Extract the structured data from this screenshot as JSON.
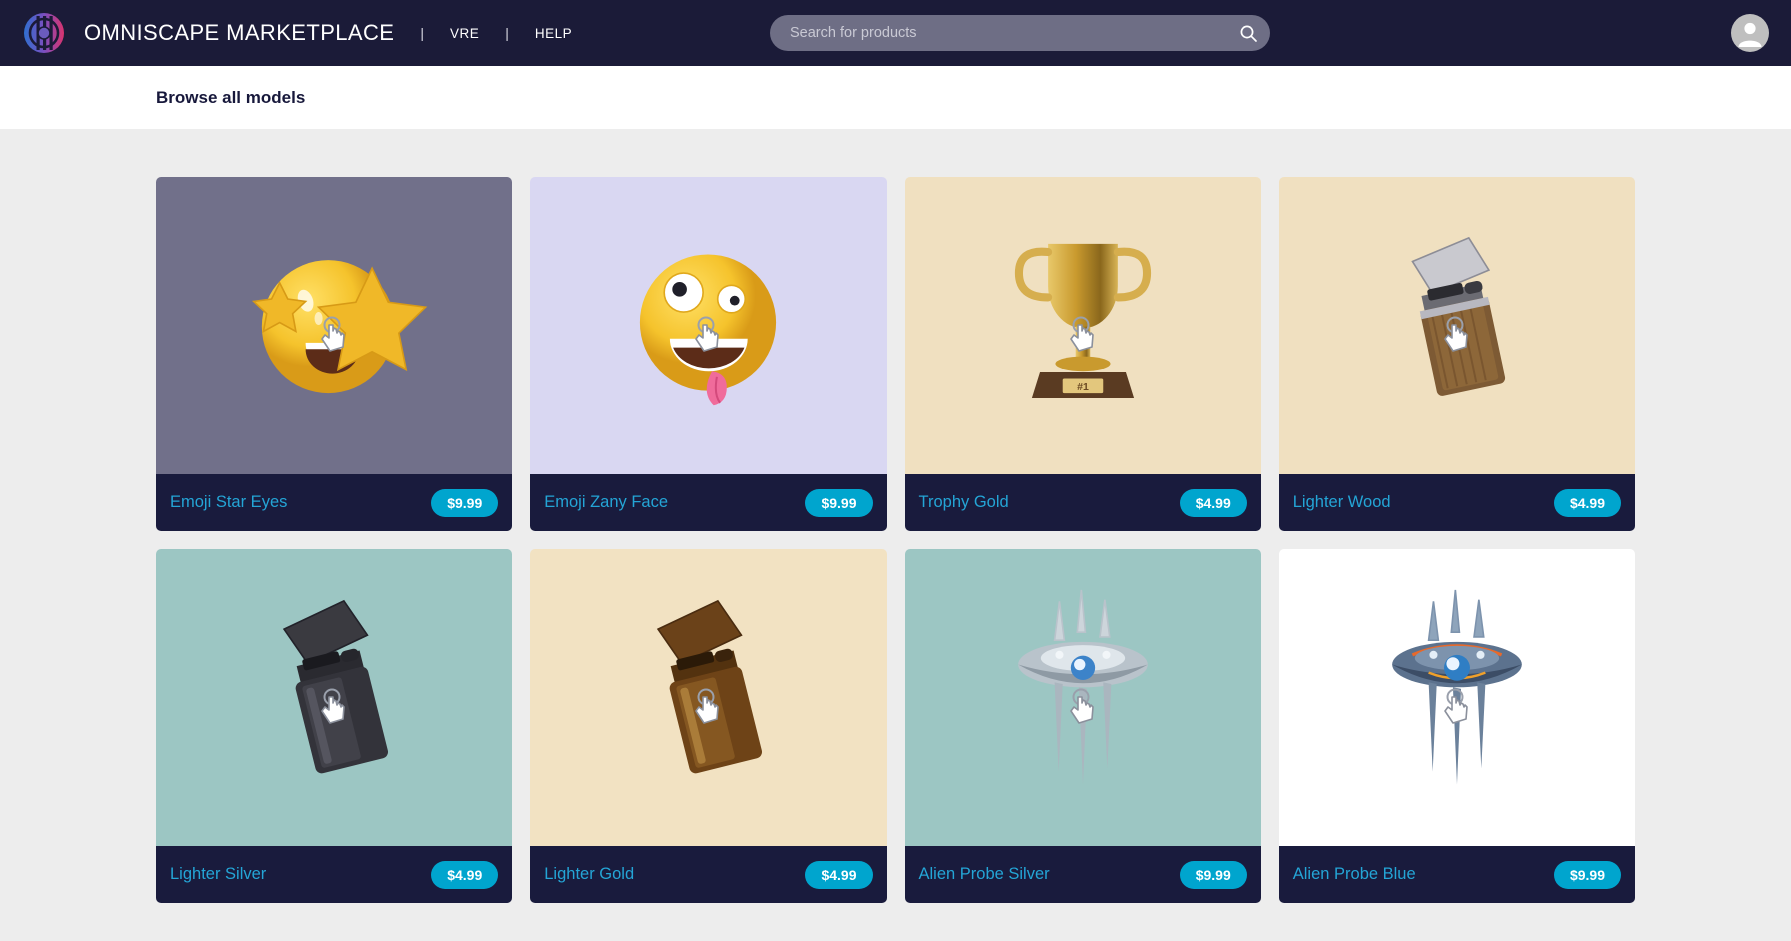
{
  "header": {
    "brand": "OMNISCAPE MARKETPLACE",
    "logo_icon": "omniscape-logo",
    "separator": "|",
    "nav": [
      {
        "label": "VRE"
      },
      {
        "label": "HELP"
      }
    ],
    "search": {
      "placeholder": "Search for products",
      "value": "",
      "icon": "search-icon"
    },
    "avatar_icon": "user-avatar-icon",
    "bg_color": "#1b1b38"
  },
  "subheader": {
    "title": "Browse all models"
  },
  "colors": {
    "accent": "#00a5ce",
    "title_text": "#24a5d6",
    "card_footer": "#191b3d",
    "page_bg": "#ededed"
  },
  "products": [
    {
      "name": "Emoji Star Eyes",
      "price": "$9.99",
      "thumb_bg": "#71708a",
      "art": "emoji-star-eyes",
      "cursor_icon": "hand-pointer-icon"
    },
    {
      "name": "Emoji Zany Face",
      "price": "$9.99",
      "thumb_bg": "#d9d7f2",
      "art": "emoji-zany-face",
      "cursor_icon": "hand-pointer-icon"
    },
    {
      "name": "Trophy Gold",
      "price": "$4.99",
      "thumb_bg": "#f0e0c0",
      "art": "trophy-gold",
      "cursor_icon": "hand-pointer-icon"
    },
    {
      "name": "Lighter Wood",
      "price": "$4.99",
      "thumb_bg": "#f0e0c0",
      "art": "lighter-wood",
      "cursor_icon": "hand-pointer-icon"
    },
    {
      "name": "Lighter Silver",
      "price": "$4.99",
      "thumb_bg": "#9cc6c3",
      "art": "lighter-silver",
      "cursor_icon": "hand-pointer-icon"
    },
    {
      "name": "Lighter Gold",
      "price": "$4.99",
      "thumb_bg": "#f2e2c2",
      "art": "lighter-gold",
      "cursor_icon": "hand-pointer-icon"
    },
    {
      "name": "Alien Probe Silver",
      "price": "$9.99",
      "thumb_bg": "#9cc6c3",
      "art": "alien-probe-silver",
      "cursor_icon": "hand-pointer-icon"
    },
    {
      "name": "Alien Probe Blue",
      "price": "$9.99",
      "thumb_bg": "#ffffff",
      "art": "alien-probe-blue",
      "cursor_icon": "hand-pointer-icon"
    }
  ]
}
